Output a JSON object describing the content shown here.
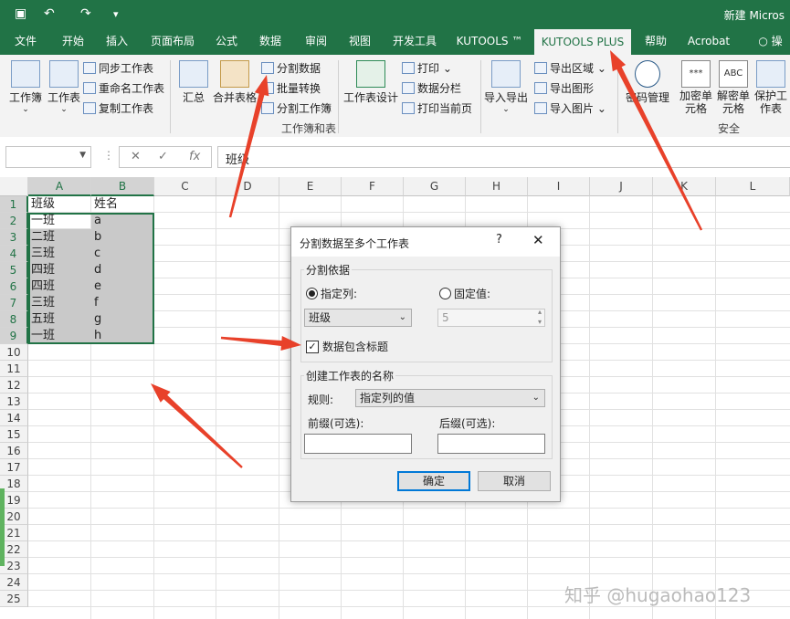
{
  "app": {
    "title": "新建 Micros",
    "accent_color": "#217346",
    "quick_access": [
      "save-icon",
      "undo-icon",
      "redo-icon",
      "customize-icon"
    ]
  },
  "tabs": [
    {
      "label": "文件"
    },
    {
      "label": "开始"
    },
    {
      "label": "插入"
    },
    {
      "label": "页面布局"
    },
    {
      "label": "公式"
    },
    {
      "label": "数据"
    },
    {
      "label": "审阅"
    },
    {
      "label": "视图"
    },
    {
      "label": "开发工具"
    },
    {
      "label": "KUTOOLS ™"
    },
    {
      "label": "KUTOOLS PLUS",
      "active": true
    },
    {
      "label": "帮助"
    },
    {
      "label": "Acrobat"
    },
    {
      "label": "操"
    }
  ],
  "ribbon": {
    "workbook": "工作簿",
    "worksheet": "工作表",
    "sync_sheets": "同步工作表",
    "rename_sheets": "重命名工作表",
    "copy_sheets": "复制工作表",
    "summary": "汇总",
    "merge_sheets": "合并表格",
    "split_data": "分割数据",
    "batch_convert": "批量转换",
    "split_workbook": "分割工作簿",
    "group_workbook_sheets": "工作簿和表",
    "sheet_design": "工作表设计",
    "print": "打印",
    "data_paging": "数据分栏",
    "print_current_page": "打印当前页",
    "import_export": "导入导出",
    "export_range": "导出区域",
    "export_graphics": "导出图形",
    "import_pictures": "导入图片",
    "password_manager": "密码管理",
    "encrypt_cells": "加密单元格",
    "decrypt_cells": "解密单元格",
    "protect_sheets": "保护工作表",
    "group_security": "安全",
    "encrypt_icon_text": "***",
    "decrypt_icon_text": "ABC"
  },
  "formula_bar": {
    "name_box": "",
    "fx": "fx",
    "content": "班级"
  },
  "sheet": {
    "columns": [
      "A",
      "B",
      "C",
      "D",
      "E",
      "F",
      "G",
      "H",
      "I",
      "J",
      "K",
      "L"
    ],
    "rows": [
      "1",
      "2",
      "3",
      "4",
      "5",
      "6",
      "7",
      "8",
      "9",
      "10",
      "11",
      "12",
      "13",
      "14",
      "15",
      "16",
      "17",
      "18",
      "19",
      "20",
      "21",
      "22",
      "23",
      "24",
      "25"
    ],
    "header": [
      "班级",
      "姓名"
    ],
    "data": [
      [
        "一班",
        "a"
      ],
      [
        "二班",
        "b"
      ],
      [
        "三班",
        "c"
      ],
      [
        "四班",
        "d"
      ],
      [
        "四班",
        "e"
      ],
      [
        "三班",
        "f"
      ],
      [
        "五班",
        "g"
      ],
      [
        "一班",
        "h"
      ]
    ]
  },
  "dialog": {
    "title": "分割数据至多个工作表",
    "help": "?",
    "close": "✕",
    "split_basis_legend": "分割依据",
    "specified_column_label": "指定列:",
    "fixed_value_label": "固定值:",
    "specified_column_value": "班级",
    "fixed_value": "5",
    "header_checkbox_label": "数据包含标题",
    "header_checked": true,
    "naming_legend": "创建工作表的名称",
    "rule_label": "规则:",
    "rule_value": "指定列的值",
    "prefix_label": "前缀(可选):",
    "suffix_label": "后缀(可选):",
    "prefix_value": "",
    "suffix_value": "",
    "ok": "确定",
    "cancel": "取消"
  },
  "watermark": "知乎 @hugaohao123",
  "arrow_color": "#e8412a"
}
